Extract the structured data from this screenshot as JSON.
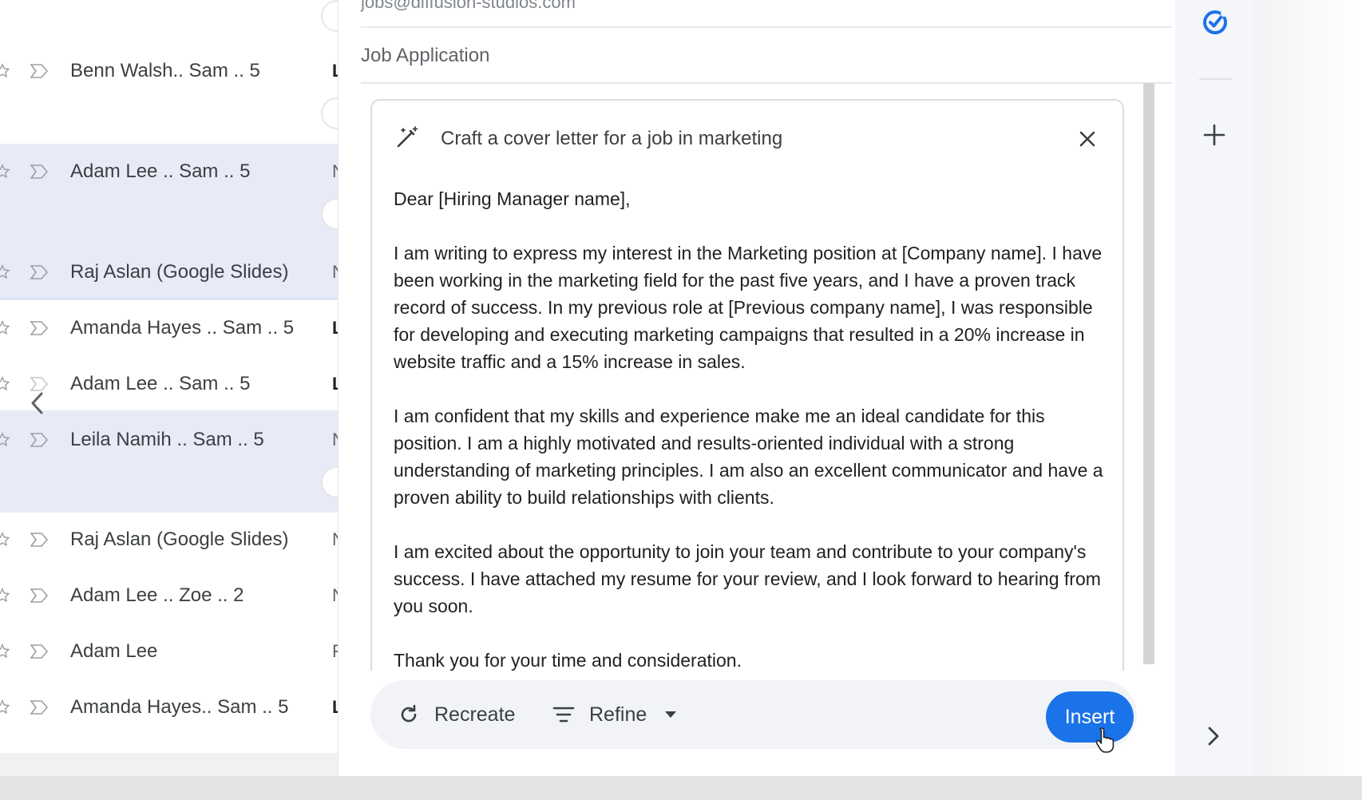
{
  "inbox": {
    "rows": [
      {
        "sender": "Benn Walsh.. Sam .. 5",
        "snippet": "L"
      },
      {
        "sender": "Adam Lee .. Sam .. 5",
        "snippet": "N"
      },
      {
        "sender": "Raj Aslan (Google Slides)",
        "snippet": "N"
      },
      {
        "sender": "Amanda Hayes .. Sam .. 5",
        "snippet": "L"
      },
      {
        "sender": "Adam Lee .. Sam .. 5",
        "snippet": "L"
      },
      {
        "sender": "Leila Namih .. Sam .. 5",
        "snippet": "N"
      },
      {
        "sender": "Raj Aslan (Google Slides)",
        "snippet": "N"
      },
      {
        "sender": "Adam Lee .. Zoe .. 2",
        "snippet": "N"
      },
      {
        "sender": "Adam Lee",
        "snippet": "F"
      },
      {
        "sender": "Amanda Hayes.. Sam .. 5",
        "snippet": "L"
      }
    ]
  },
  "compose": {
    "to": "jobs@diffusion-studios.com",
    "subject": "Job Application",
    "help_me_write": {
      "prompt": "Craft a cover letter for a job in marketing",
      "letter": [
        "Dear [Hiring Manager name],",
        "I am writing to express my interest in the Marketing position at [Company name]. I have been working in the marketing field for the past five years, and I have a proven track record of success. In my previous role at [Previous company name], I was responsible for developing and executing marketing campaigns that resulted in a 20% increase in website traffic and a 15% increase in sales.",
        "I am confident that my skills and experience make me an ideal candidate for this position. I am a highly motivated and results-oriented individual with a strong understanding of marketing principles. I am also an excellent communicator and have a proven ability to build relationships with clients.",
        "I am excited about the opportunity to join your team and contribute to your company's success. I have attached my resume for your review, and I look forward to hearing from you soon.",
        "Thank you for your time and consideration."
      ]
    },
    "actions": {
      "recreate": "Recreate",
      "refine": "Refine",
      "insert": "Insert"
    }
  },
  "colors": {
    "accent": "#1a73e8",
    "selected_row": "#e8ebf7"
  },
  "icons": [
    "star-icon",
    "importance-marker-icon",
    "chevron-left-icon",
    "magic-wand-icon",
    "close-icon",
    "refresh-icon",
    "filter-icon",
    "caret-down-icon",
    "tasks-icon",
    "add-icon",
    "chevron-right-icon",
    "hand-cursor-icon"
  ]
}
